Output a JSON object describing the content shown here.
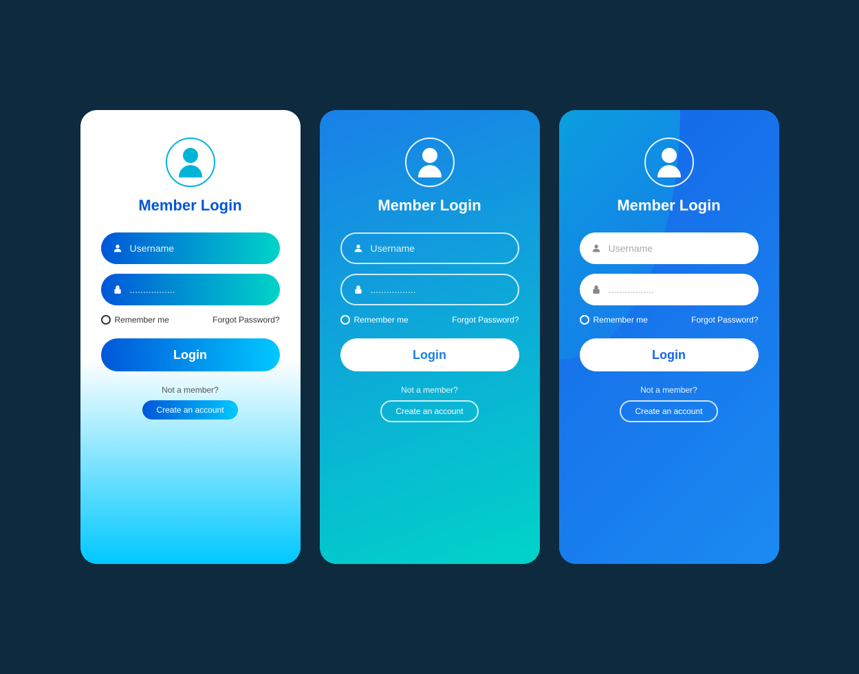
{
  "background": "#0d2a3e",
  "cards": [
    {
      "id": "card-1",
      "title": "Member Login",
      "username_placeholder": "Username",
      "password_placeholder": ".................",
      "remember_label": "Remember me",
      "forgot_label": "Forgot Password?",
      "login_label": "Login",
      "not_member_label": "Not a member?",
      "create_account_label": "Create an account"
    },
    {
      "id": "card-2",
      "title": "Member Login",
      "username_placeholder": "Username",
      "password_placeholder": ".................",
      "remember_label": "Remember me",
      "forgot_label": "Forgot Password?",
      "login_label": "Login",
      "not_member_label": "Not a member?",
      "create_account_label": "Create an account"
    },
    {
      "id": "card-3",
      "title": "Member Login",
      "username_placeholder": "Username",
      "password_placeholder": ".................",
      "remember_label": "Remember me",
      "forgot_label": "Forgot Password?",
      "login_label": "Login",
      "not_member_label": "Not a member?",
      "create_account_label": "Create an account"
    }
  ]
}
